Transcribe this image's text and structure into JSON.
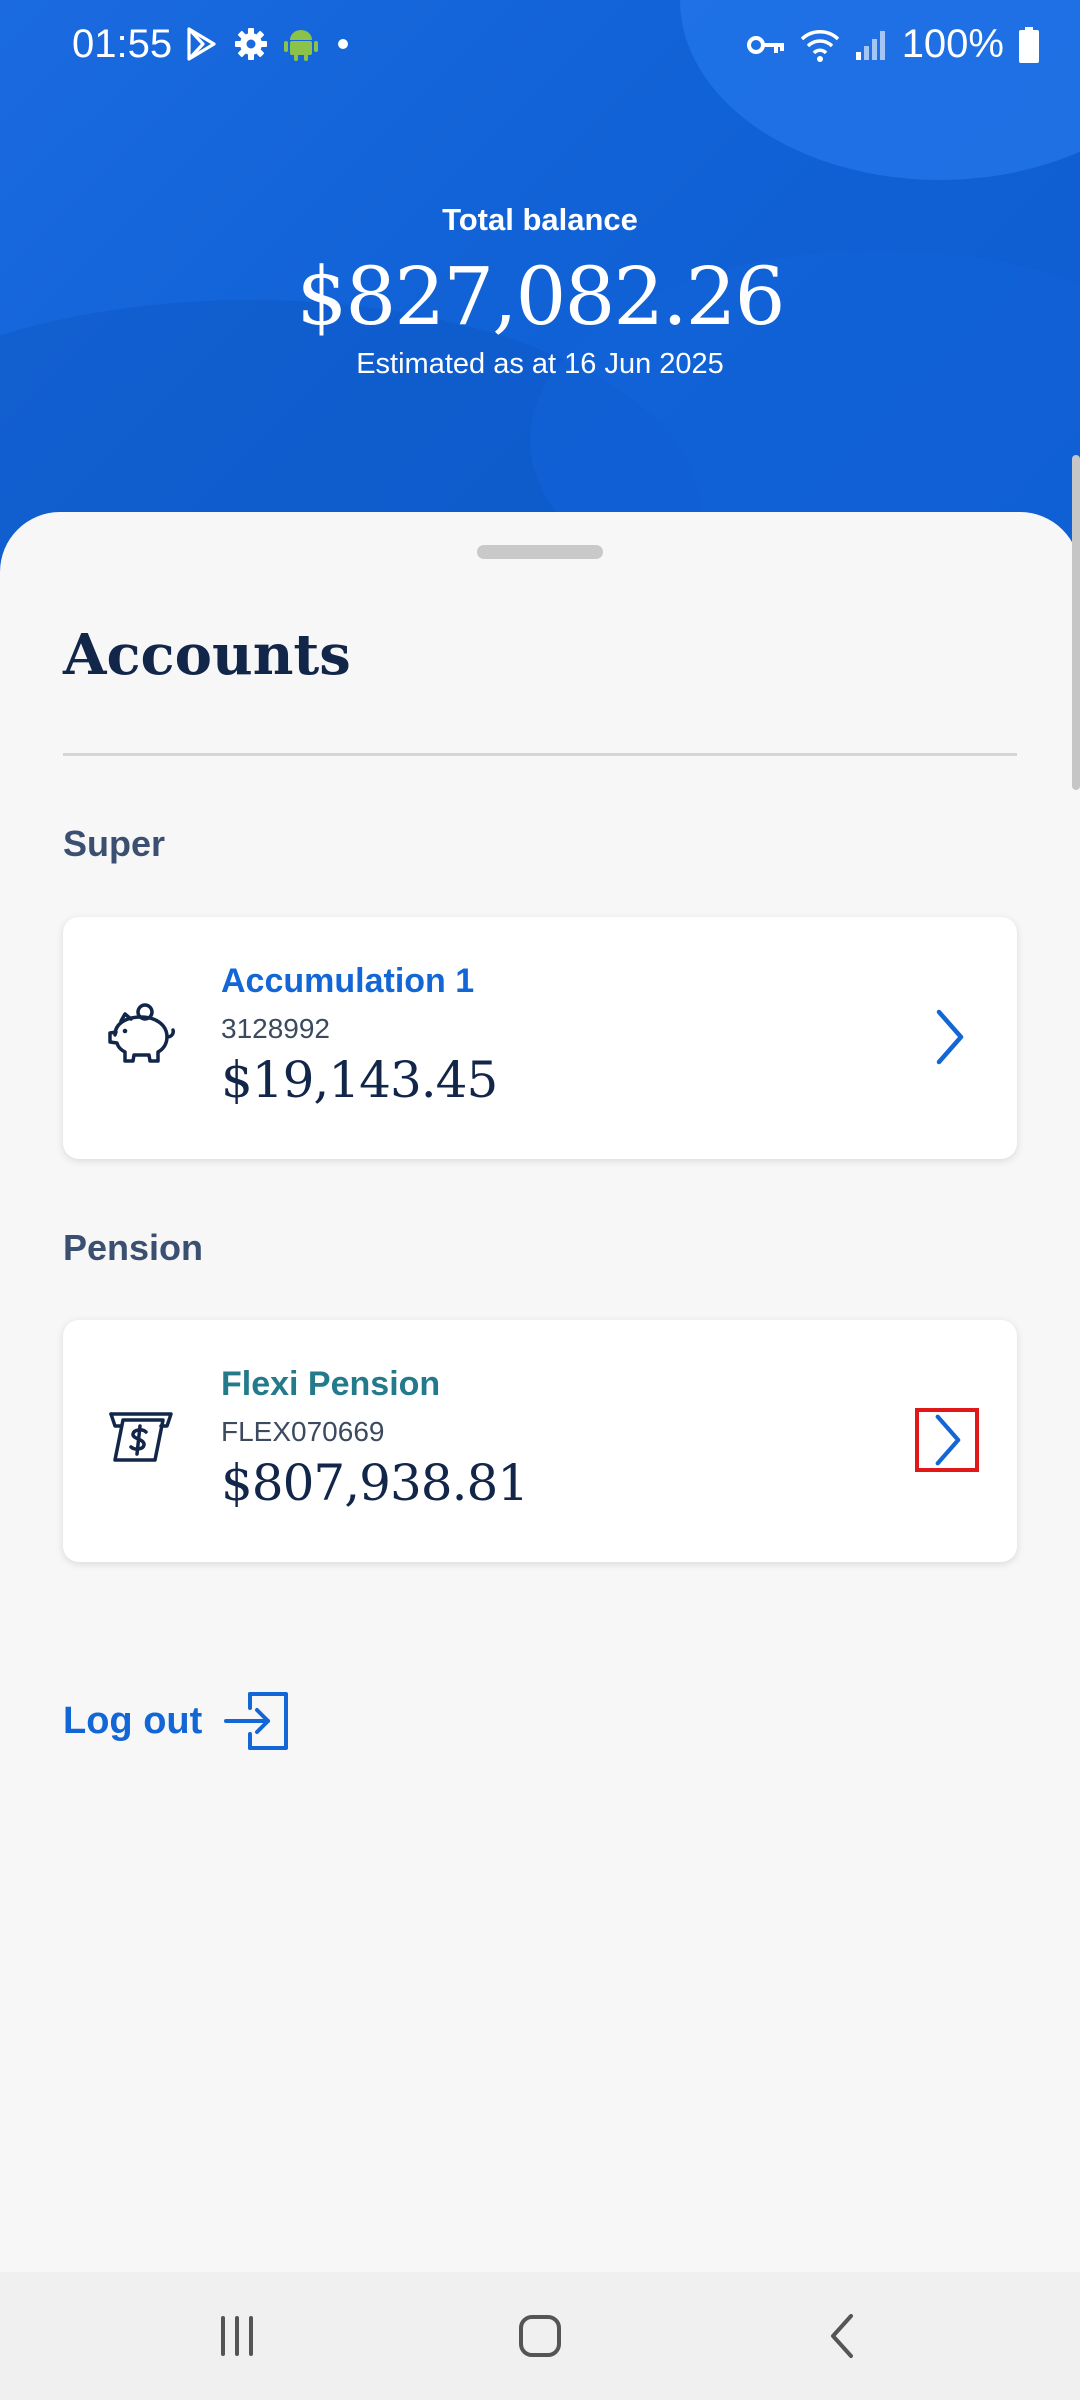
{
  "status_bar": {
    "time": "01:55",
    "battery_percent": "100%",
    "left_icons": [
      "play-store-icon",
      "gear-icon",
      "android-icon",
      "dot-icon"
    ],
    "right_icons": [
      "key-icon",
      "wifi-icon",
      "signal-icon",
      "battery-icon"
    ]
  },
  "header": {
    "balance_label": "Total balance",
    "balance_amount": "$827,082.26",
    "balance_date": "Estimated as at 16 Jun 2025"
  },
  "accounts": {
    "title": "Accounts",
    "sections": [
      {
        "label": "Super",
        "card": {
          "icon": "piggy-bank-icon",
          "name": "Accumulation 1",
          "name_color": "#1366d6",
          "number": "3128992",
          "amount": "$19,143.45"
        }
      },
      {
        "label": "Pension",
        "card": {
          "icon": "pension-cash-icon",
          "name": "Flexi Pension",
          "name_color": "#237a8a",
          "number": "FLEX070669",
          "amount": "$807,938.81"
        }
      }
    ]
  },
  "logout": {
    "label": "Log out",
    "icon": "logout-icon"
  },
  "colors": {
    "header_blue": "#1162d6",
    "accent_blue": "#1366d6",
    "navy": "#12264a",
    "teal": "#237a8a",
    "highlight_red": "#e01818"
  },
  "nav_bar": {
    "buttons": [
      "recent-apps-icon",
      "home-icon",
      "back-icon"
    ]
  }
}
